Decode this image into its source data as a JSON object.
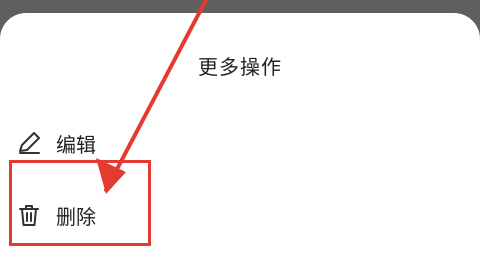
{
  "sheet": {
    "title": "更多操作"
  },
  "menu": {
    "items": [
      {
        "label": "编辑",
        "icon": "pencil-icon"
      },
      {
        "label": "删除",
        "icon": "trash-icon"
      }
    ]
  },
  "annotation": {
    "color": "#e33b2f"
  }
}
